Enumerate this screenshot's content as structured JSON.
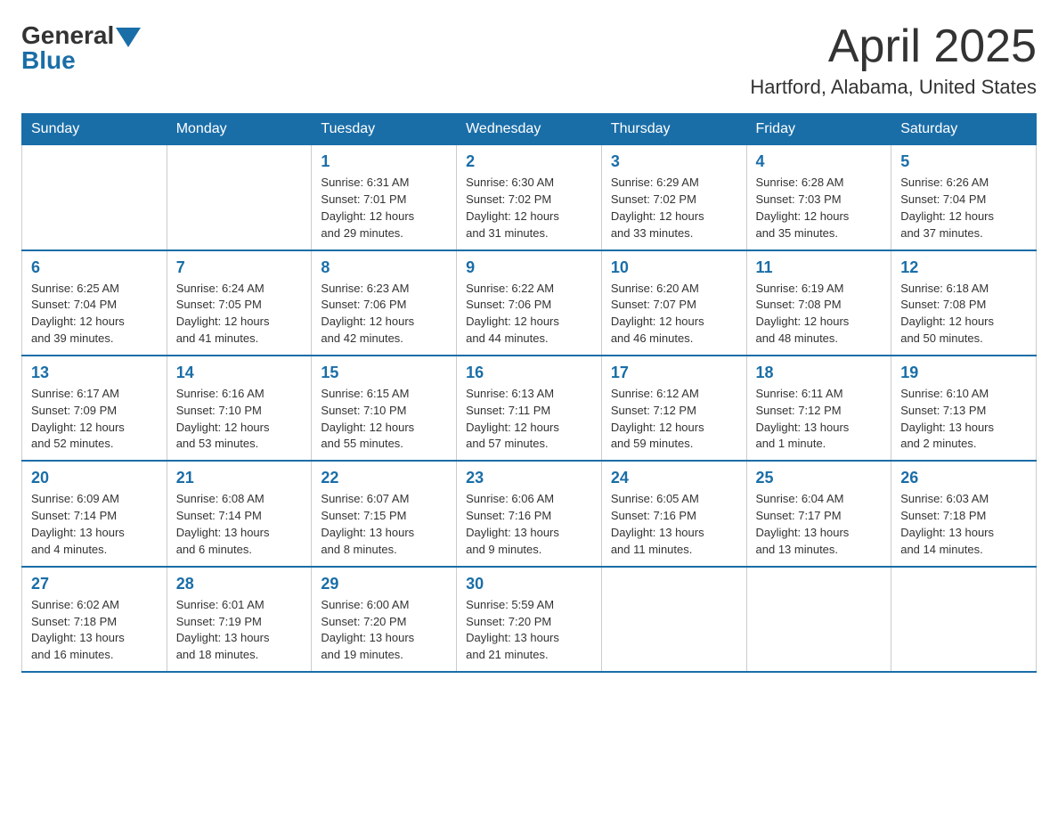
{
  "header": {
    "logo_general": "General",
    "logo_blue": "Blue",
    "month_title": "April 2025",
    "location": "Hartford, Alabama, United States"
  },
  "weekdays": [
    "Sunday",
    "Monday",
    "Tuesday",
    "Wednesday",
    "Thursday",
    "Friday",
    "Saturday"
  ],
  "weeks": [
    [
      {
        "day": "",
        "info": ""
      },
      {
        "day": "",
        "info": ""
      },
      {
        "day": "1",
        "info": "Sunrise: 6:31 AM\nSunset: 7:01 PM\nDaylight: 12 hours\nand 29 minutes."
      },
      {
        "day": "2",
        "info": "Sunrise: 6:30 AM\nSunset: 7:02 PM\nDaylight: 12 hours\nand 31 minutes."
      },
      {
        "day": "3",
        "info": "Sunrise: 6:29 AM\nSunset: 7:02 PM\nDaylight: 12 hours\nand 33 minutes."
      },
      {
        "day": "4",
        "info": "Sunrise: 6:28 AM\nSunset: 7:03 PM\nDaylight: 12 hours\nand 35 minutes."
      },
      {
        "day": "5",
        "info": "Sunrise: 6:26 AM\nSunset: 7:04 PM\nDaylight: 12 hours\nand 37 minutes."
      }
    ],
    [
      {
        "day": "6",
        "info": "Sunrise: 6:25 AM\nSunset: 7:04 PM\nDaylight: 12 hours\nand 39 minutes."
      },
      {
        "day": "7",
        "info": "Sunrise: 6:24 AM\nSunset: 7:05 PM\nDaylight: 12 hours\nand 41 minutes."
      },
      {
        "day": "8",
        "info": "Sunrise: 6:23 AM\nSunset: 7:06 PM\nDaylight: 12 hours\nand 42 minutes."
      },
      {
        "day": "9",
        "info": "Sunrise: 6:22 AM\nSunset: 7:06 PM\nDaylight: 12 hours\nand 44 minutes."
      },
      {
        "day": "10",
        "info": "Sunrise: 6:20 AM\nSunset: 7:07 PM\nDaylight: 12 hours\nand 46 minutes."
      },
      {
        "day": "11",
        "info": "Sunrise: 6:19 AM\nSunset: 7:08 PM\nDaylight: 12 hours\nand 48 minutes."
      },
      {
        "day": "12",
        "info": "Sunrise: 6:18 AM\nSunset: 7:08 PM\nDaylight: 12 hours\nand 50 minutes."
      }
    ],
    [
      {
        "day": "13",
        "info": "Sunrise: 6:17 AM\nSunset: 7:09 PM\nDaylight: 12 hours\nand 52 minutes."
      },
      {
        "day": "14",
        "info": "Sunrise: 6:16 AM\nSunset: 7:10 PM\nDaylight: 12 hours\nand 53 minutes."
      },
      {
        "day": "15",
        "info": "Sunrise: 6:15 AM\nSunset: 7:10 PM\nDaylight: 12 hours\nand 55 minutes."
      },
      {
        "day": "16",
        "info": "Sunrise: 6:13 AM\nSunset: 7:11 PM\nDaylight: 12 hours\nand 57 minutes."
      },
      {
        "day": "17",
        "info": "Sunrise: 6:12 AM\nSunset: 7:12 PM\nDaylight: 12 hours\nand 59 minutes."
      },
      {
        "day": "18",
        "info": "Sunrise: 6:11 AM\nSunset: 7:12 PM\nDaylight: 13 hours\nand 1 minute."
      },
      {
        "day": "19",
        "info": "Sunrise: 6:10 AM\nSunset: 7:13 PM\nDaylight: 13 hours\nand 2 minutes."
      }
    ],
    [
      {
        "day": "20",
        "info": "Sunrise: 6:09 AM\nSunset: 7:14 PM\nDaylight: 13 hours\nand 4 minutes."
      },
      {
        "day": "21",
        "info": "Sunrise: 6:08 AM\nSunset: 7:14 PM\nDaylight: 13 hours\nand 6 minutes."
      },
      {
        "day": "22",
        "info": "Sunrise: 6:07 AM\nSunset: 7:15 PM\nDaylight: 13 hours\nand 8 minutes."
      },
      {
        "day": "23",
        "info": "Sunrise: 6:06 AM\nSunset: 7:16 PM\nDaylight: 13 hours\nand 9 minutes."
      },
      {
        "day": "24",
        "info": "Sunrise: 6:05 AM\nSunset: 7:16 PM\nDaylight: 13 hours\nand 11 minutes."
      },
      {
        "day": "25",
        "info": "Sunrise: 6:04 AM\nSunset: 7:17 PM\nDaylight: 13 hours\nand 13 minutes."
      },
      {
        "day": "26",
        "info": "Sunrise: 6:03 AM\nSunset: 7:18 PM\nDaylight: 13 hours\nand 14 minutes."
      }
    ],
    [
      {
        "day": "27",
        "info": "Sunrise: 6:02 AM\nSunset: 7:18 PM\nDaylight: 13 hours\nand 16 minutes."
      },
      {
        "day": "28",
        "info": "Sunrise: 6:01 AM\nSunset: 7:19 PM\nDaylight: 13 hours\nand 18 minutes."
      },
      {
        "day": "29",
        "info": "Sunrise: 6:00 AM\nSunset: 7:20 PM\nDaylight: 13 hours\nand 19 minutes."
      },
      {
        "day": "30",
        "info": "Sunrise: 5:59 AM\nSunset: 7:20 PM\nDaylight: 13 hours\nand 21 minutes."
      },
      {
        "day": "",
        "info": ""
      },
      {
        "day": "",
        "info": ""
      },
      {
        "day": "",
        "info": ""
      }
    ]
  ]
}
